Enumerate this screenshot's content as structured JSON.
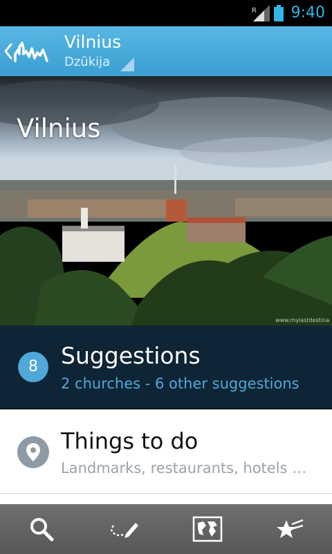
{
  "status_bar": {
    "roaming_indicator": "R",
    "time": "9:40",
    "accent_color": "#33b5e5"
  },
  "action_bar": {
    "title": "Vilnius",
    "subtitle": "Dzūkija",
    "color": "#4aaedd"
  },
  "hero": {
    "title": "Vilnius",
    "credit": "www.mylastdestina"
  },
  "suggestions": {
    "count": "8",
    "title": "Suggestions",
    "subtitle": "2 churches - 6 other suggestions"
  },
  "things_to_do": {
    "title": "Things to do",
    "subtitle": "Landmarks, restaurants, hotels …"
  },
  "toolbar": {
    "items": [
      "search-icon",
      "draw-route-icon",
      "world-map-icon",
      "favorites-icon"
    ]
  }
}
